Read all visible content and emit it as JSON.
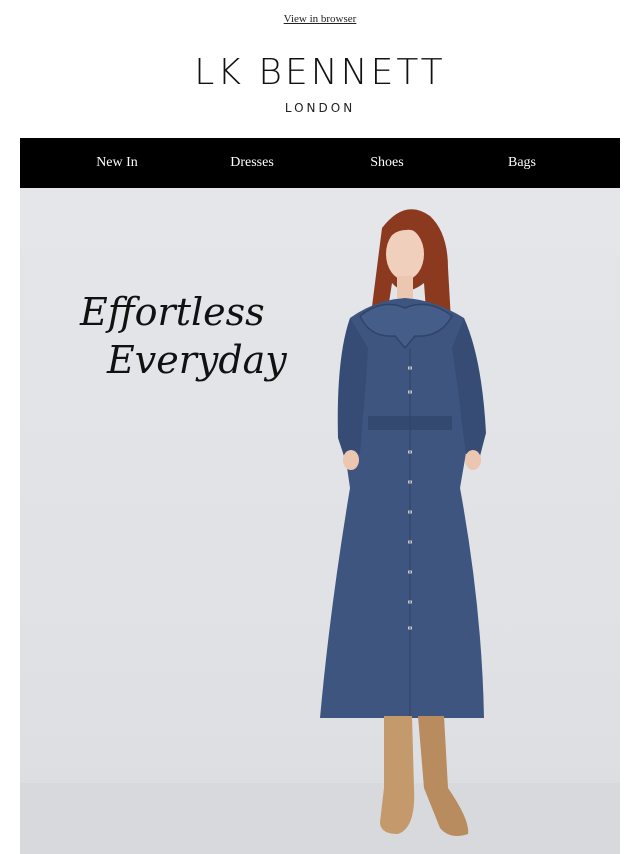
{
  "header": {
    "view_in_browser": "View in browser",
    "brand_name": "LK BENNETT",
    "brand_sub": "LONDON"
  },
  "nav": {
    "items": [
      {
        "label": "New In"
      },
      {
        "label": "Dresses"
      },
      {
        "label": "Shoes"
      },
      {
        "label": "Bags"
      }
    ]
  },
  "hero": {
    "headline_line1": "Effortless",
    "headline_line2": "Everyday"
  },
  "colors": {
    "nav_bg": "#000000",
    "dress": "#3e557f",
    "boots": "#c49a6c",
    "hair": "#8b3a1f"
  }
}
